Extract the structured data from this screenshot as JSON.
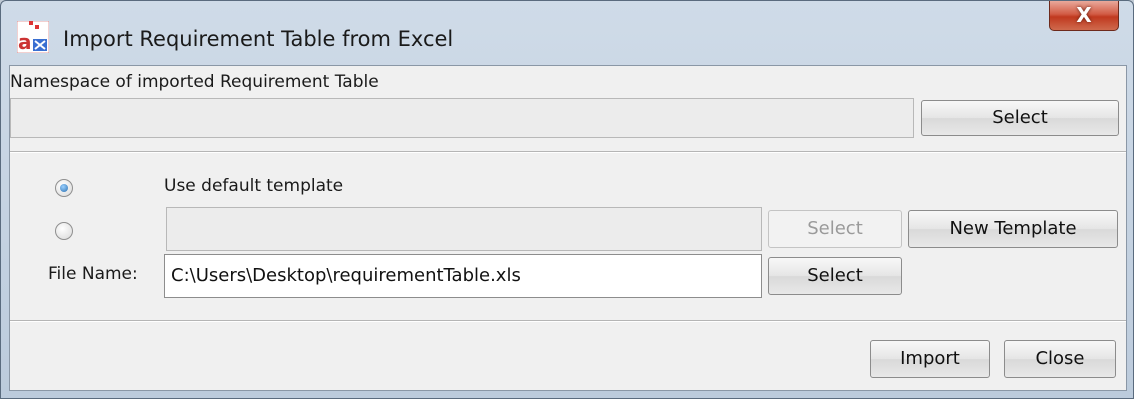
{
  "window": {
    "title": "Import Requirement Table from Excel",
    "close_label": "X"
  },
  "namespace": {
    "label": "Namespace of imported Requirement Table",
    "value": "",
    "select_label": "Select"
  },
  "template": {
    "default_option_label": "Use default template",
    "default_selected": true,
    "custom_value": "",
    "custom_select_label": "Select",
    "new_template_label": "New Template"
  },
  "file": {
    "label": "File Name:",
    "value": "C:\\Users\\Desktop\\requirementTable.xls",
    "select_label": "Select"
  },
  "footer": {
    "import_label": "Import",
    "close_label": "Close"
  },
  "colors": {
    "close_button": "#c0391f",
    "radio_selected": "#2a6fb0"
  }
}
